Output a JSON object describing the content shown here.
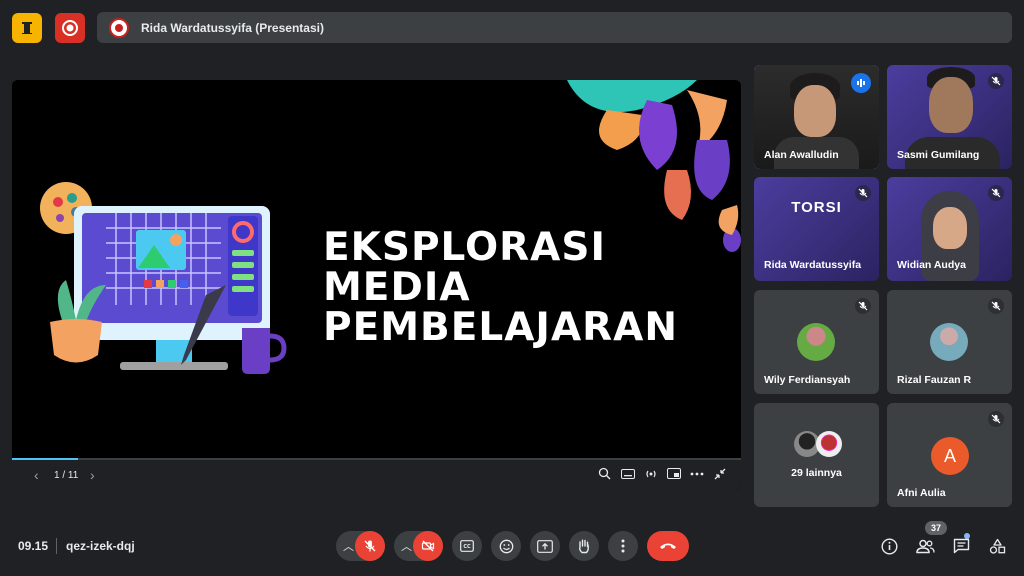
{
  "top": {
    "presenter_title": "Rida Wardatussyifa (Presentasi)"
  },
  "slide": {
    "title_lines": [
      "EKSPLORASI",
      "MEDIA",
      "PEMBELAJARAN"
    ],
    "page_indicator": "1 / 11",
    "progress_fraction": 0.09
  },
  "participants": [
    {
      "name": "Alan Awalludin",
      "state": "speaking"
    },
    {
      "name": "Sasmi Gumilang",
      "state": "muted"
    },
    {
      "name": "Rida Wardatussyifa",
      "state": "muted",
      "overlay": "TORSI"
    },
    {
      "name": "Widian Audya",
      "state": "muted"
    },
    {
      "name": "Wily Ferdiansyah",
      "state": "muted"
    },
    {
      "name": "Rizal Fauzan R",
      "state": "muted"
    },
    {
      "name": "29 lainnya",
      "state": "group"
    },
    {
      "name": "Afni Aulia",
      "state": "muted",
      "initial": "A"
    }
  ],
  "bottom": {
    "time": "09.15",
    "meeting_code": "qez-izek-dqj",
    "people_count": "37"
  },
  "colors": {
    "accent": "#8ab4f8",
    "danger": "#ea4335",
    "surface": "#3c4043",
    "background": "#202124"
  }
}
